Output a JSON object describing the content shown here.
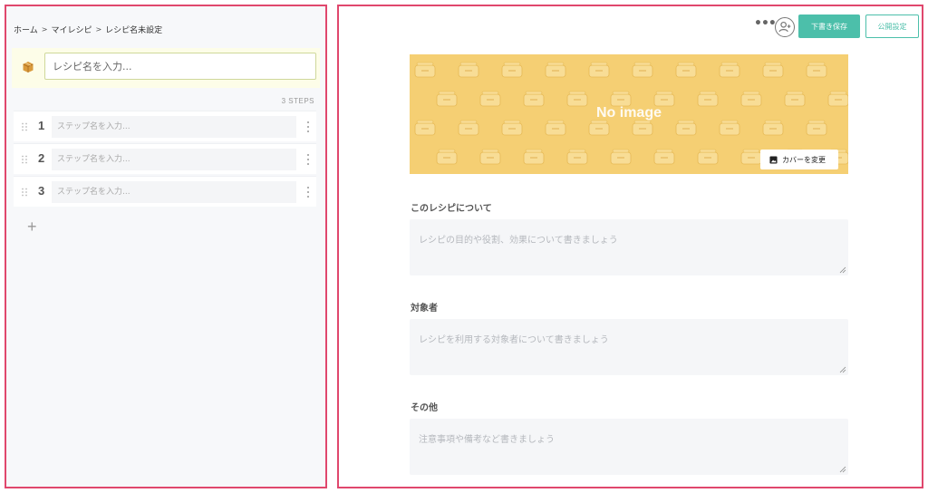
{
  "breadcrumb": {
    "home": "ホーム",
    "my_recipes": "マイレシピ",
    "current": "レシピ名未設定",
    "separator": ">"
  },
  "recipe_name": {
    "placeholder": "レシピ名を入力...",
    "icon": "box-icon"
  },
  "steps_count": "3 STEPS",
  "steps": [
    {
      "number": "1",
      "placeholder": "ステップ名を入力..."
    },
    {
      "number": "2",
      "placeholder": "ステップ名を入力..."
    },
    {
      "number": "3",
      "placeholder": "ステップ名を入力..."
    }
  ],
  "add_step_label": "+",
  "toolbar": {
    "more_label": "•••",
    "save_draft_label": "下書き保存",
    "publish_label": "公開設定"
  },
  "cover": {
    "no_image_label": "No image",
    "change_cover_label": "カバーを変更"
  },
  "sections": {
    "about": {
      "label": "このレシピについて",
      "placeholder": "レシピの目的や役割、効果について書きましょう"
    },
    "audience": {
      "label": "対象者",
      "placeholder": "レシピを利用する対象者について書きましょう"
    },
    "other": {
      "label": "その他",
      "placeholder": "注意事項や備考など書きましょう"
    }
  },
  "colors": {
    "accent": "#4cbfaa",
    "frame": "#e0476d",
    "cover_bg": "#f5cf73"
  }
}
